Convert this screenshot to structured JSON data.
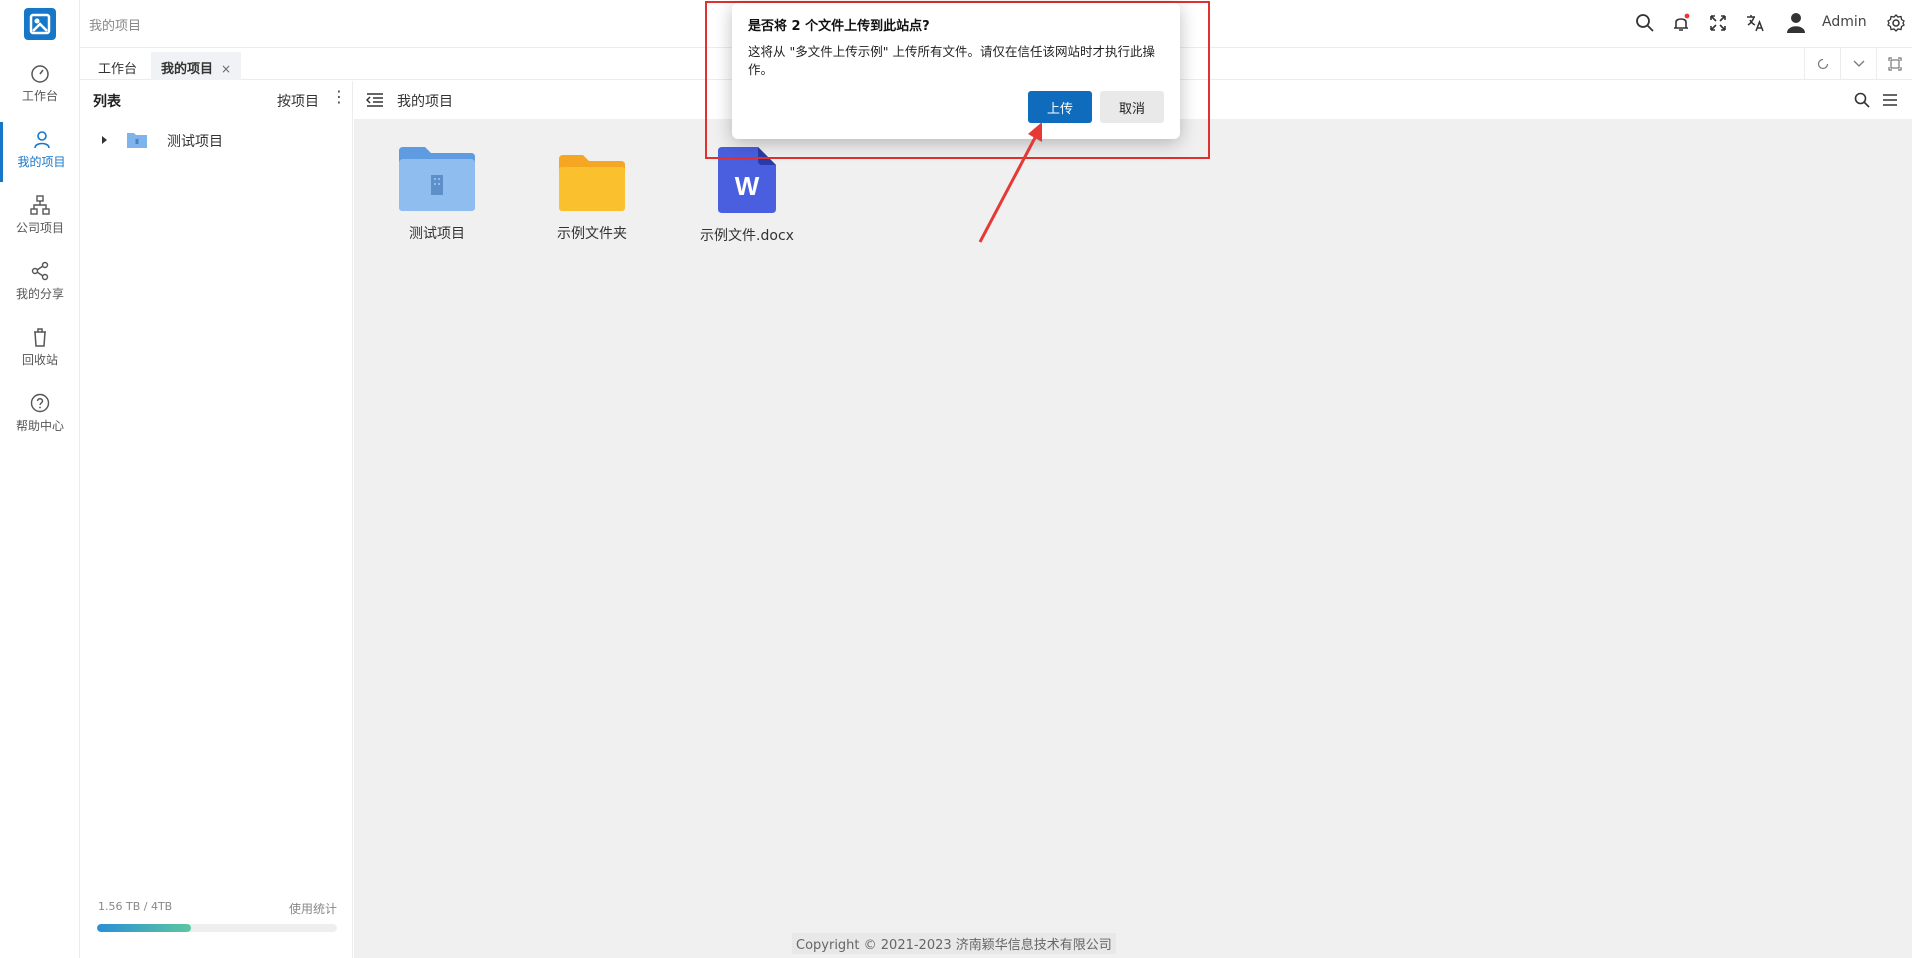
{
  "sidebar": {
    "items": [
      {
        "label": "工作台",
        "icon": "dashboard-icon"
      },
      {
        "label": "我的项目",
        "icon": "user-icon",
        "active": true
      },
      {
        "label": "公司项目",
        "icon": "org-chart-icon"
      },
      {
        "label": "我的分享",
        "icon": "share-icon"
      },
      {
        "label": "回收站",
        "icon": "trash-icon"
      },
      {
        "label": "帮助中心",
        "icon": "help-icon"
      }
    ]
  },
  "header": {
    "breadcrumb": "我的项目",
    "user": "Admin",
    "icons": [
      "search-icon",
      "bell-icon",
      "fullscreen-icon",
      "translate-icon",
      "avatar",
      "settings-icon"
    ]
  },
  "tabs": [
    {
      "label": "工作台"
    },
    {
      "label": "我的项目",
      "close": "×"
    }
  ],
  "left_panel": {
    "title": "列表",
    "sort_label": "按项目",
    "more": "⋮",
    "tree": [
      {
        "label": "测试项目"
      }
    ],
    "usage_text": "1.56 TB / 4TB",
    "usage_stats_label": "使用统计",
    "usage_fraction": 0.39
  },
  "main": {
    "title": "我的项目",
    "files": [
      {
        "name": "测试项目",
        "type": "project-folder"
      },
      {
        "name": "示例文件夹",
        "type": "folder"
      },
      {
        "name": "示例文件.docx",
        "type": "word-doc",
        "glyph": "W"
      }
    ],
    "copyright": "Copyright © 2021-2023 济南颖华信息技术有限公司"
  },
  "dialog": {
    "title": "是否将 2 个文件上传到此站点?",
    "message": "这将从 \"多文件上传示例\" 上传所有文件。请仅在信任该网站时才执行此操作。",
    "upload_label": "上传",
    "cancel_label": "取消"
  },
  "colors": {
    "accent": "#1677c8",
    "highlight": "#e03030",
    "folder_yellow": "#fbc02d",
    "folder_blue": "#7fb3ec",
    "word_blue": "#4a5fe0"
  }
}
